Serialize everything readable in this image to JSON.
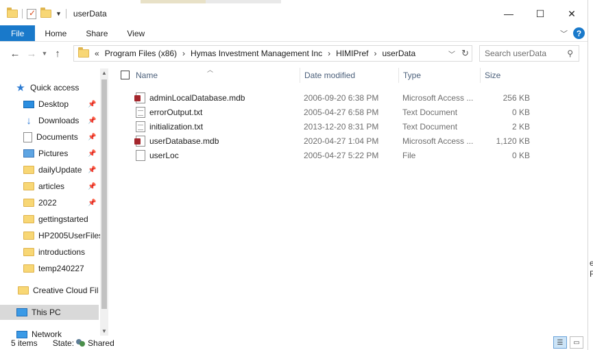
{
  "window": {
    "title": "userData"
  },
  "titlebar": {
    "minimize": "—",
    "maximize": "☐",
    "close": "✕"
  },
  "ribbon": {
    "tabs": [
      {
        "label": "File"
      },
      {
        "label": "Home"
      },
      {
        "label": "Share"
      },
      {
        "label": "View"
      }
    ],
    "help": "?"
  },
  "address": {
    "overflow": "«",
    "crumbs": [
      "Program Files (x86)",
      "Hymas Investment Management Inc",
      "HIMIPref",
      "userData"
    ]
  },
  "search": {
    "placeholder": "Search userData"
  },
  "nav": {
    "quick_access": "Quick access",
    "pinned": [
      {
        "label": "Desktop",
        "icon": "desktop-icon"
      },
      {
        "label": "Downloads",
        "icon": "download-icon"
      },
      {
        "label": "Documents",
        "icon": "document-icon"
      },
      {
        "label": "Pictures",
        "icon": "pictures-icon"
      },
      {
        "label": "dailyUpdate",
        "icon": "folder-icon"
      },
      {
        "label": "articles",
        "icon": "folder-icon"
      },
      {
        "label": "2022",
        "icon": "folder-icon"
      }
    ],
    "recent": [
      "gettingstarted",
      "HP2005UserFiles",
      "introductions",
      "temp240227"
    ],
    "creative_cloud": "Creative Cloud Files",
    "this_pc": "This PC",
    "network": "Network"
  },
  "columns": {
    "name": "Name",
    "date": "Date modified",
    "type": "Type",
    "size": "Size"
  },
  "files": [
    {
      "name": "adminLocalDatabase.mdb",
      "date": "2006-09-20 6:38 PM",
      "type": "Microsoft Access ...",
      "size": "256 KB",
      "icon": "mdb"
    },
    {
      "name": "errorOutput.txt",
      "date": "2005-04-27 6:58 PM",
      "type": "Text Document",
      "size": "0 KB",
      "icon": "txt"
    },
    {
      "name": "initialization.txt",
      "date": "2013-12-20 8:31 PM",
      "type": "Text Document",
      "size": "2 KB",
      "icon": "txt"
    },
    {
      "name": "userDatabase.mdb",
      "date": "2020-04-27 1:04 PM",
      "type": "Microsoft Access ...",
      "size": "1,120 KB",
      "icon": "mdb"
    },
    {
      "name": "userLoc",
      "date": "2005-04-27 5:22 PM",
      "type": "File",
      "size": "0 KB",
      "icon": "blank"
    }
  ],
  "status": {
    "items": "5 items",
    "state_label": "State:",
    "state_value": "Shared"
  },
  "background": {
    "right_text_1": "e",
    "right_text_2": "F"
  }
}
